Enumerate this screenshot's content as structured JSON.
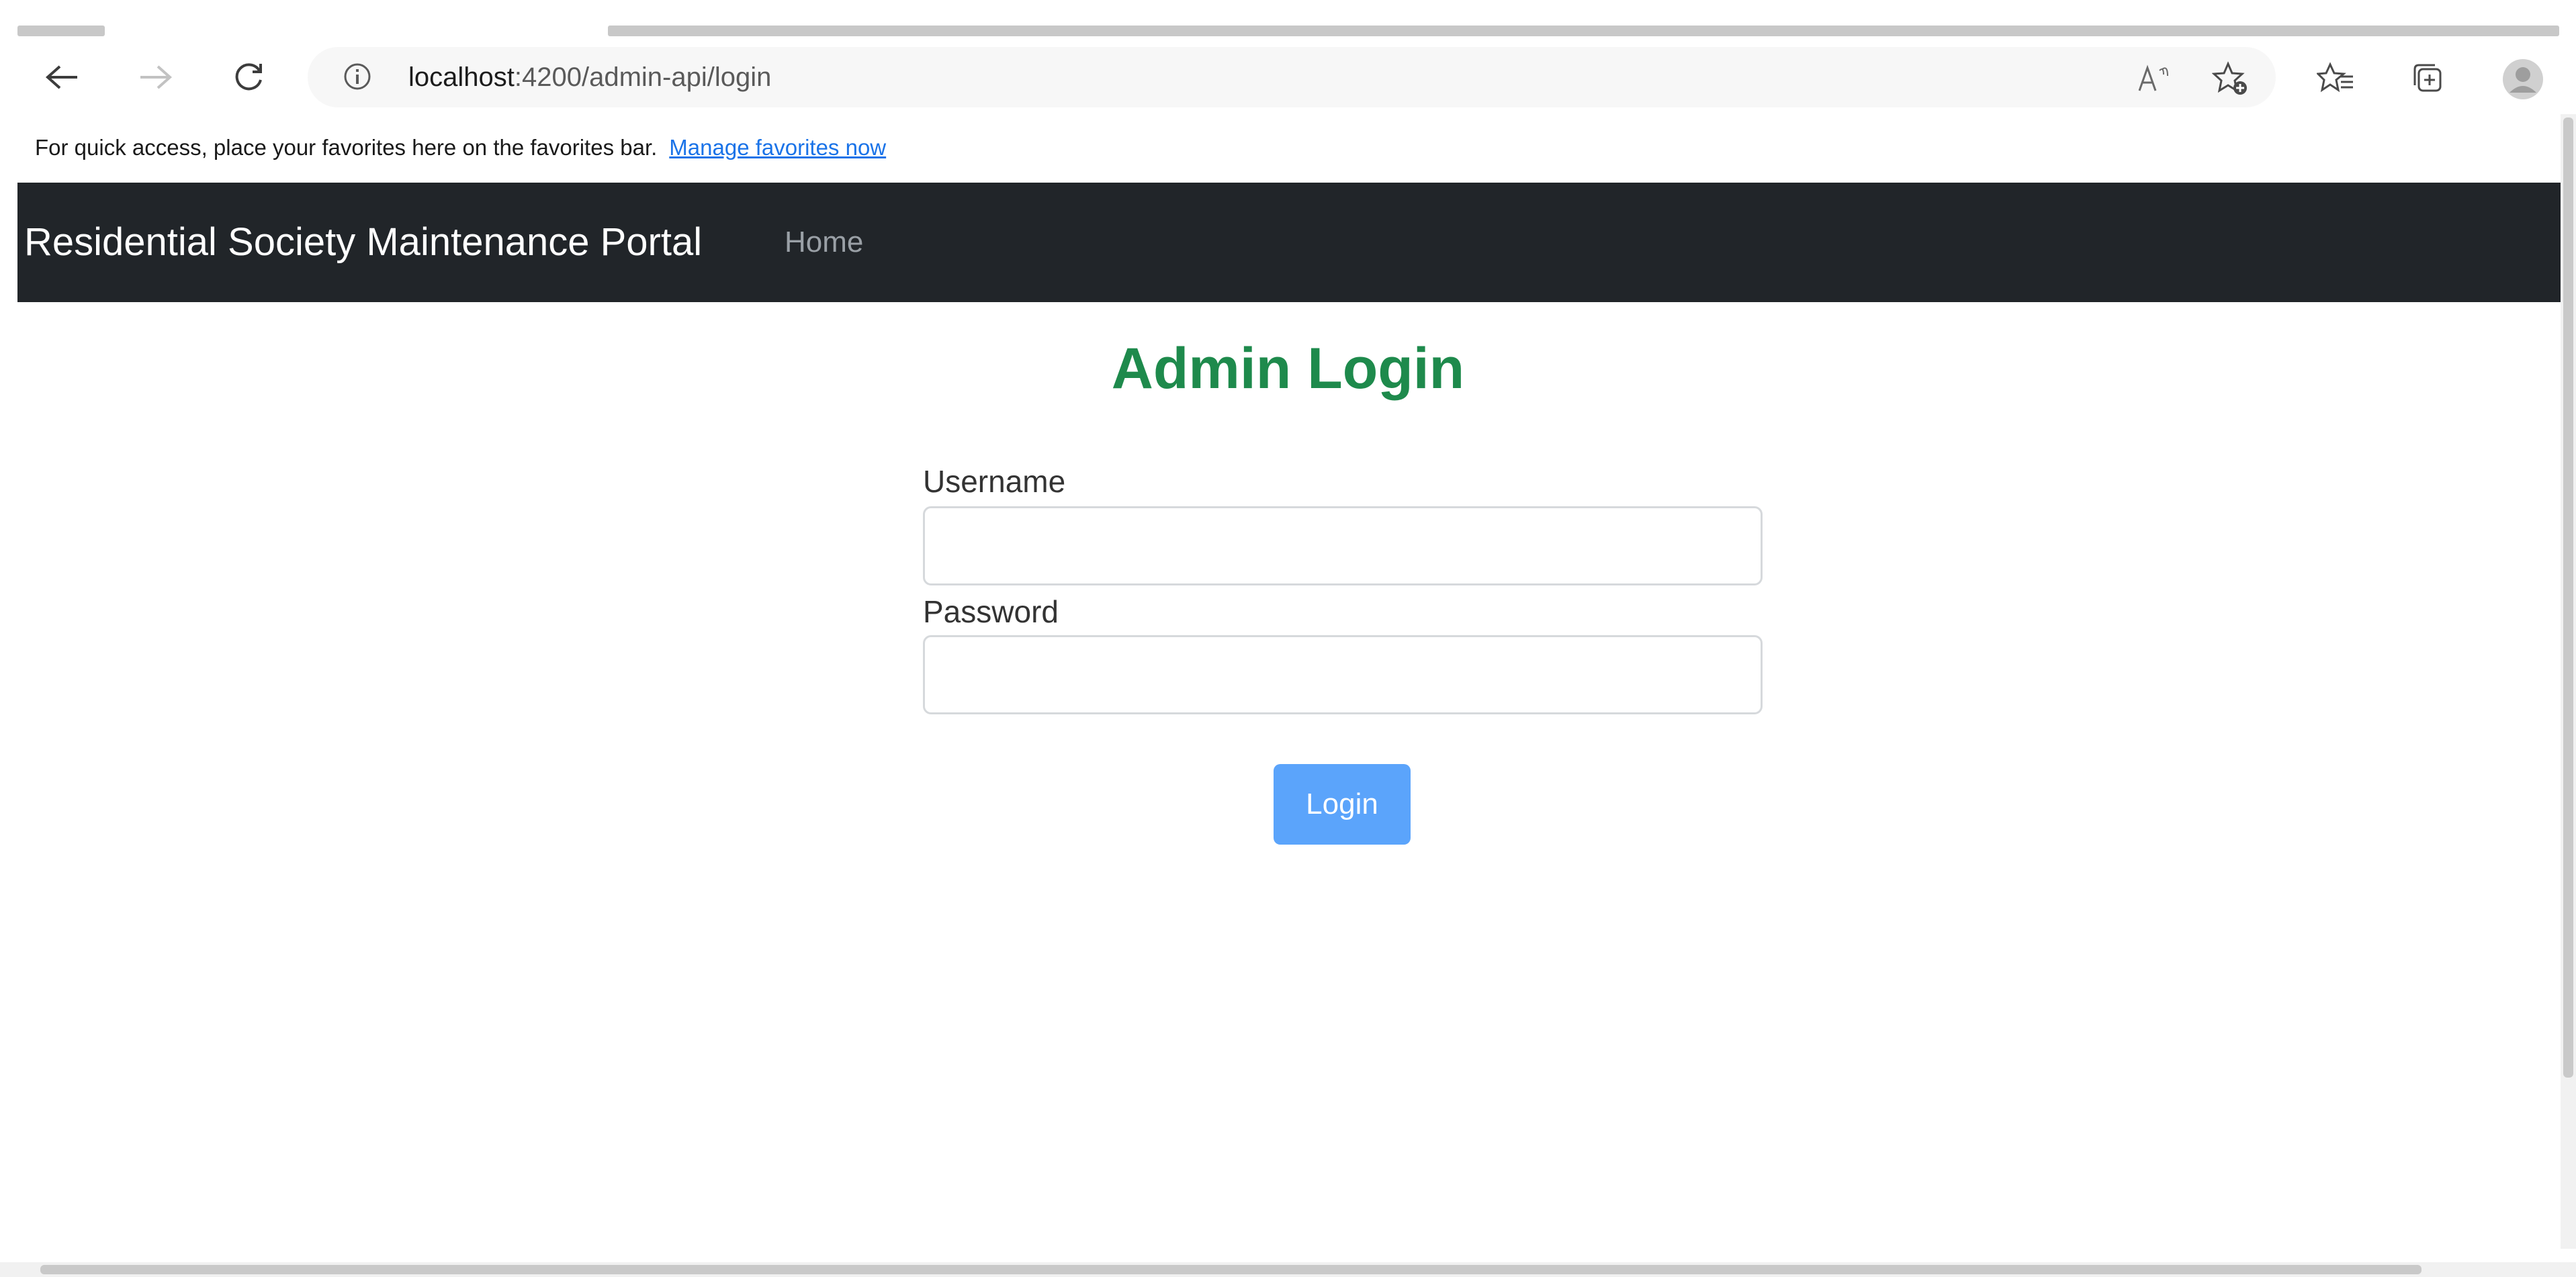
{
  "browser": {
    "url_host": "localhost",
    "url_path": ":4200/admin-api/login",
    "icons": [
      "back-arrow-icon",
      "forward-arrow-icon",
      "refresh-icon",
      "info-icon",
      "read-aloud-icon",
      "add-favorite-icon",
      "favorites-icon",
      "collections-icon",
      "profile-icon"
    ]
  },
  "favorites_bar": {
    "message": "For quick access, place your favorites here on the favorites bar.",
    "link": "Manage favorites now"
  },
  "navbar": {
    "brand": "Residential Society Maintenance Portal",
    "home": "Home"
  },
  "login": {
    "title": "Admin Login",
    "username_label": "Username",
    "username_value": "",
    "password_label": "Password",
    "password_value": "",
    "submit_label": "Login"
  },
  "colors": {
    "navbar": "#212529",
    "title": "#1e8a4c",
    "button": "#5ba4fb"
  }
}
